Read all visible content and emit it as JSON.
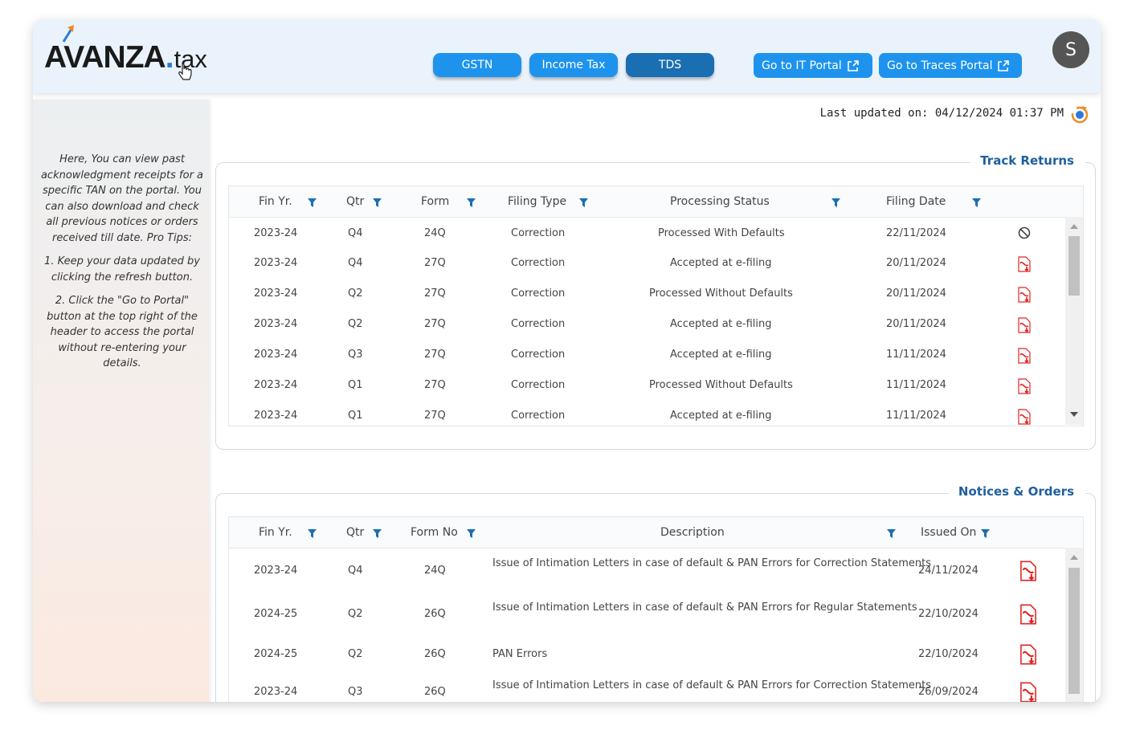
{
  "header": {
    "logo_main": "AVANZA",
    "logo_dot": ".",
    "logo_tax": "tax",
    "tabs": [
      {
        "label": "GSTN"
      },
      {
        "label": "Income Tax"
      },
      {
        "label": "TDS"
      }
    ],
    "portal_it": "Go to IT Portal",
    "portal_traces": "Go to Traces Portal",
    "avatar_initial": "S"
  },
  "sidebar": {
    "intro": "Here, You can view past acknowledgment receipts for a specific TAN on the portal. You can also download and check all previous notices or orders received till date. Pro Tips:",
    "tip1": "1. Keep your data updated by clicking the refresh button.",
    "tip2": "2. Click the \"Go to Portal\" button at the top right of the header to access the portal without re-entering your details."
  },
  "last_updated": "Last updated on: 04/12/2024 01:37 PM",
  "track_returns": {
    "title": "Track Returns",
    "columns": [
      "Fin Yr.",
      "Qtr",
      "Form",
      "Filing Type",
      "Processing Status",
      "Filing Date"
    ],
    "rows": [
      {
        "fy": "2023-24",
        "qtr": "Q4",
        "form": "24Q",
        "type": "Correction",
        "status": "Processed With Defaults",
        "date": "22/11/2024",
        "icon": "blocked-icon"
      },
      {
        "fy": "2023-24",
        "qtr": "Q4",
        "form": "27Q",
        "type": "Correction",
        "status": "Accepted at e-filing",
        "date": "20/11/2024",
        "icon": "pdf-icon"
      },
      {
        "fy": "2023-24",
        "qtr": "Q2",
        "form": "27Q",
        "type": "Correction",
        "status": "Processed Without Defaults",
        "date": "20/11/2024",
        "icon": "pdf-icon"
      },
      {
        "fy": "2023-24",
        "qtr": "Q2",
        "form": "27Q",
        "type": "Correction",
        "status": "Accepted at e-filing",
        "date": "20/11/2024",
        "icon": "pdf-icon"
      },
      {
        "fy": "2023-24",
        "qtr": "Q3",
        "form": "27Q",
        "type": "Correction",
        "status": "Accepted at e-filing",
        "date": "11/11/2024",
        "icon": "pdf-icon"
      },
      {
        "fy": "2023-24",
        "qtr": "Q1",
        "form": "27Q",
        "type": "Correction",
        "status": "Processed Without Defaults",
        "date": "11/11/2024",
        "icon": "pdf-icon"
      },
      {
        "fy": "2023-24",
        "qtr": "Q1",
        "form": "27Q",
        "type": "Correction",
        "status": "Accepted at e-filing",
        "date": "11/11/2024",
        "icon": "pdf-icon"
      }
    ]
  },
  "notices": {
    "title": "Notices & Orders",
    "columns": [
      "Fin Yr.",
      "Qtr",
      "Form No",
      "Description",
      "Issued On"
    ],
    "rows": [
      {
        "fy": "2023-24",
        "qtr": "Q4",
        "form": "24Q",
        "desc": "Issue of Intimation Letters in case of default & PAN Errors for Correction Statements",
        "date": "24/11/2024"
      },
      {
        "fy": "2024-25",
        "qtr": "Q2",
        "form": "26Q",
        "desc": "Issue of Intimation Letters in case of default & PAN Errors for Regular Statements",
        "date": "22/10/2024"
      },
      {
        "fy": "2024-25",
        "qtr": "Q2",
        "form": "26Q",
        "desc": "PAN Errors",
        "date": "22/10/2024"
      },
      {
        "fy": "2023-24",
        "qtr": "Q3",
        "form": "26Q",
        "desc": "Issue of Intimation Letters in case of default & PAN Errors for Correction Statements",
        "date": "26/09/2024"
      }
    ]
  },
  "colors": {
    "accent": "#1e93ee",
    "accent_dark": "#1a6fb3",
    "title": "#1f5f9e",
    "pdf": "#e02424"
  }
}
